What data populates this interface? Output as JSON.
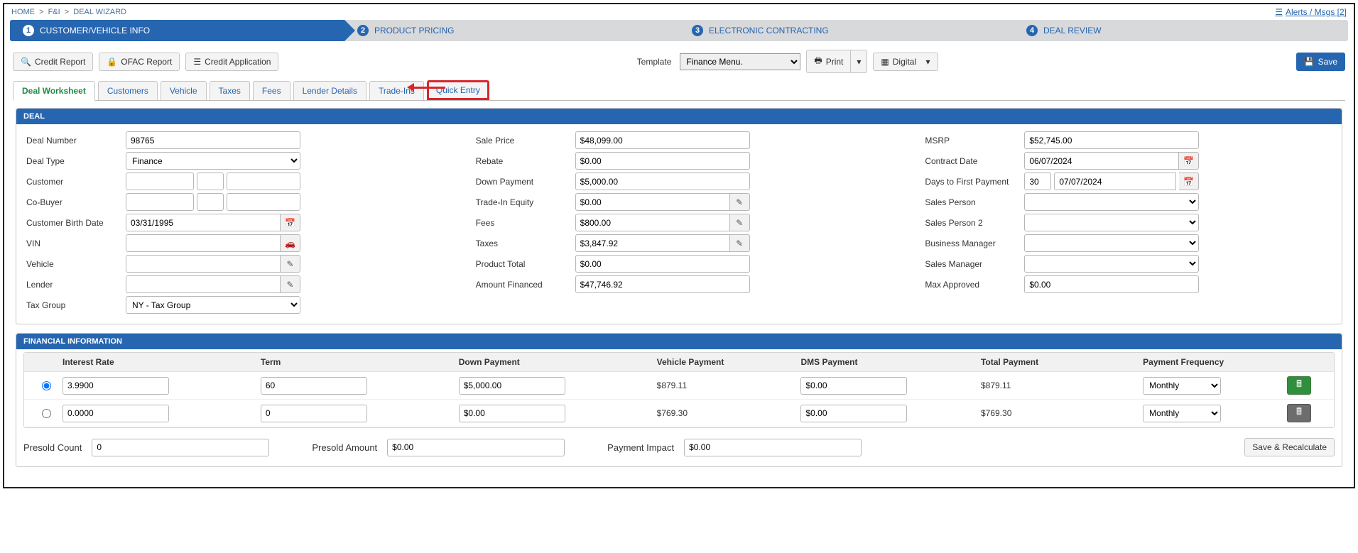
{
  "breadcrumb": {
    "home": "HOME",
    "fi": "F&I",
    "wizard": "DEAL WIZARD"
  },
  "alerts": "Alerts / Msgs [2]",
  "wizard_steps": [
    {
      "n": "1",
      "label": "CUSTOMER/VEHICLE INFO"
    },
    {
      "n": "2",
      "label": "PRODUCT PRICING"
    },
    {
      "n": "3",
      "label": "ELECTRONIC CONTRACTING"
    },
    {
      "n": "4",
      "label": "DEAL REVIEW"
    }
  ],
  "toolbar": {
    "credit_report": "Credit Report",
    "ofac_report": "OFAC Report",
    "credit_app": "Credit Application",
    "template_lbl": "Template",
    "template_val": "Finance Menu.",
    "print": "Print",
    "digital": "Digital",
    "save": "Save"
  },
  "tabs": [
    "Deal Worksheet",
    "Customers",
    "Vehicle",
    "Taxes",
    "Fees",
    "Lender Details",
    "Trade-Ins",
    "Quick Entry"
  ],
  "deal": {
    "header": "DEAL",
    "labels": {
      "deal_number": "Deal Number",
      "deal_type": "Deal Type",
      "customer": "Customer",
      "co_buyer": "Co-Buyer",
      "birth": "Customer Birth Date",
      "vin": "VIN",
      "vehicle": "Vehicle",
      "lender": "Lender",
      "tax_group": "Tax Group",
      "sale_price": "Sale Price",
      "rebate": "Rebate",
      "down_payment": "Down Payment",
      "trade_in": "Trade-In Equity",
      "fees": "Fees",
      "taxes": "Taxes",
      "product_total": "Product Total",
      "amount_financed": "Amount Financed",
      "msrp": "MSRP",
      "contract_date": "Contract Date",
      "days_first": "Days to First Payment",
      "sales_person": "Sales Person",
      "sales_person2": "Sales Person 2",
      "biz_mgr": "Business Manager",
      "sales_mgr": "Sales Manager",
      "max_approved": "Max Approved"
    },
    "values": {
      "deal_number": "98765",
      "deal_type": "Finance",
      "birth": "03/31/1995",
      "tax_group": "NY - Tax Group",
      "sale_price": "$48,099.00",
      "rebate": "$0.00",
      "down_payment": "$5,000.00",
      "trade_in": "$0.00",
      "fees": "$800.00",
      "taxes": "$3,847.92",
      "product_total": "$0.00",
      "amount_financed": "$47,746.92",
      "msrp": "$52,745.00",
      "contract_date": "06/07/2024",
      "days": "30",
      "first_pay_date": "07/07/2024",
      "max_approved": "$0.00"
    }
  },
  "fin": {
    "header": "FINANCIAL INFORMATION",
    "heads": {
      "rate": "Interest Rate",
      "term": "Term",
      "down": "Down Payment",
      "veh": "Vehicle Payment",
      "dms": "DMS Payment",
      "total": "Total Payment",
      "freq": "Payment Frequency"
    },
    "rows": [
      {
        "sel": true,
        "rate": "3.9900",
        "term": "60",
        "down": "$5,000.00",
        "veh": "$879.11",
        "dms": "$0.00",
        "total": "$879.11",
        "freq": "Monthly",
        "green": true
      },
      {
        "sel": false,
        "rate": "0.0000",
        "term": "0",
        "down": "$0.00",
        "veh": "$769.30",
        "dms": "$0.00",
        "total": "$769.30",
        "freq": "Monthly",
        "green": false
      }
    ],
    "presold": {
      "count_lbl": "Presold Count",
      "count": "0",
      "amount_lbl": "Presold Amount",
      "amount": "$0.00",
      "impact_lbl": "Payment Impact",
      "impact": "$0.00",
      "recalc": "Save & Recalculate"
    }
  }
}
